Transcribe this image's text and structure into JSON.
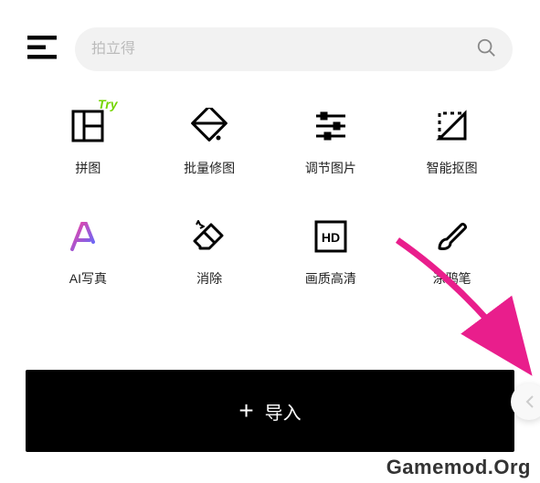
{
  "search": {
    "placeholder": "拍立得"
  },
  "grid": {
    "items": [
      {
        "label": "拼图",
        "badge": "Try",
        "badge_color": "#74d400"
      },
      {
        "label": "批量修图"
      },
      {
        "label": "调节图片"
      },
      {
        "label": "智能抠图"
      },
      {
        "label": "AI写真"
      },
      {
        "label": "消除"
      },
      {
        "label": "画质高清"
      },
      {
        "label": "涂鸦笔"
      }
    ]
  },
  "watermark": "Gamemod.Org",
  "colors": {
    "ai_gradient_start": "#f43fa0",
    "ai_gradient_end": "#5b6cff",
    "arrow": "#e91e8c"
  },
  "import": {
    "label": "导入",
    "plus": "+"
  }
}
